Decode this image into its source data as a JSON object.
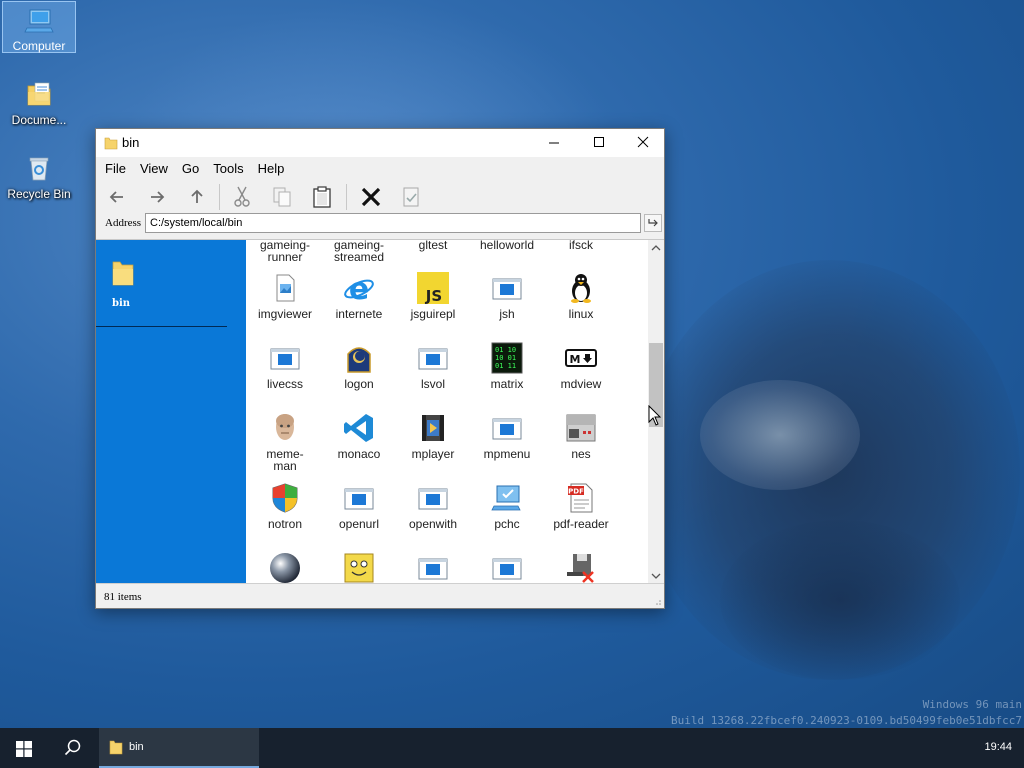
{
  "desktop": {
    "icons": [
      {
        "label": "Computer",
        "icon": "computer-icon"
      },
      {
        "label": "Docume...",
        "icon": "documents-icon"
      },
      {
        "label": "Recycle Bin",
        "icon": "recycle-bin-icon"
      }
    ],
    "watermark": {
      "line1": "Windows 96 main",
      "line2": "Build 13268.22fbcef0.240923-0109.bd50499feb0e51dbfcc7"
    }
  },
  "window": {
    "title": "bin",
    "menu": [
      "File",
      "View",
      "Go",
      "Tools",
      "Help"
    ],
    "address_label": "Address",
    "address_value": "C:/system/local/bin",
    "sidebar": {
      "folder_label": "bin"
    },
    "files_partial": [
      {
        "label": "gameing-runner"
      },
      {
        "label": "gameing-streamed"
      },
      {
        "label": "gltest"
      },
      {
        "label": "helloworld"
      },
      {
        "label": "ifsck"
      }
    ],
    "files": [
      {
        "label": "imgviewer",
        "icon": "image-viewer-icon"
      },
      {
        "label": "internete",
        "icon": "internet-explorer-icon"
      },
      {
        "label": "jsguirepl",
        "icon": "js-icon"
      },
      {
        "label": "jsh",
        "icon": "app-window-icon"
      },
      {
        "label": "linux",
        "icon": "tux-icon"
      },
      {
        "label": "livecss",
        "icon": "app-window-icon"
      },
      {
        "label": "logon",
        "icon": "logon-icon"
      },
      {
        "label": "lsvol",
        "icon": "app-window-icon"
      },
      {
        "label": "matrix",
        "icon": "matrix-icon"
      },
      {
        "label": "mdview",
        "icon": "markdown-icon"
      },
      {
        "label": "meme-man",
        "icon": "meme-man-icon"
      },
      {
        "label": "monaco",
        "icon": "vscode-icon"
      },
      {
        "label": "mplayer",
        "icon": "media-player-icon"
      },
      {
        "label": "mpmenu",
        "icon": "app-window-icon"
      },
      {
        "label": "nes",
        "icon": "nes-icon"
      },
      {
        "label": "notron",
        "icon": "shield-icon"
      },
      {
        "label": "openurl",
        "icon": "app-window-icon"
      },
      {
        "label": "openwith",
        "icon": "app-window-icon"
      },
      {
        "label": "pchc",
        "icon": "pc-check-icon"
      },
      {
        "label": "pdf-reader",
        "icon": "pdf-icon"
      }
    ],
    "files_bottom_icons": [
      "sphere-icon",
      "sponge-icon",
      "app-window-icon",
      "app-window-icon",
      "disk-delete-icon"
    ],
    "status": "81 items"
  },
  "taskbar": {
    "task_label": "bin",
    "clock": "19:44"
  },
  "colors": {
    "accent": "#0a78d7",
    "taskbar": "#17212e"
  }
}
